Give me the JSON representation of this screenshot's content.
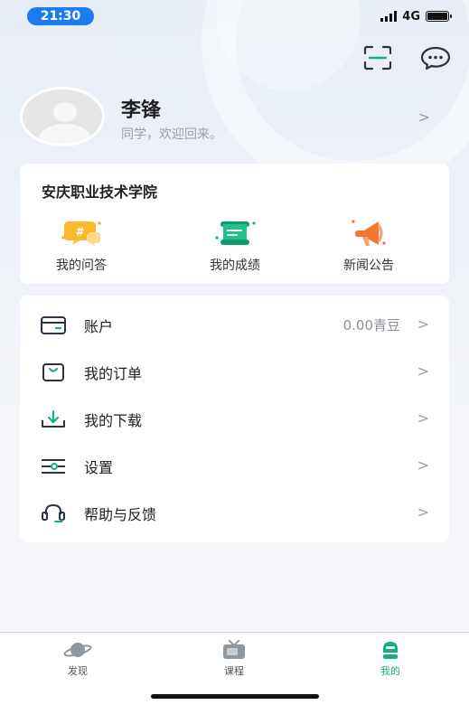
{
  "status_bar": {
    "time": "21:30",
    "network": "4G",
    "battery_level": 0.9
  },
  "header": {
    "scan_icon": "scan-icon",
    "message_icon": "chat-icon"
  },
  "profile": {
    "name": "李锋",
    "greeting": "同学，欢迎回来。",
    "chevron": ">"
  },
  "school": {
    "title": "安庆职业技术学院",
    "features": [
      {
        "label": "我的问答",
        "icon": "qa-bubble-icon",
        "color": "#f5a623"
      },
      {
        "label": "我的成绩",
        "icon": "scroll-icon",
        "color": "#18b07a"
      },
      {
        "label": "新闻公告",
        "icon": "megaphone-icon",
        "color": "#f26b2e"
      }
    ]
  },
  "menu": {
    "items": [
      {
        "label": "账户",
        "value": "0.00青豆",
        "icon": "wallet-icon",
        "chevron": ">"
      },
      {
        "label": "我的订单",
        "value": "",
        "icon": "order-bag-icon",
        "chevron": ">"
      },
      {
        "label": "我的下载",
        "value": "",
        "icon": "download-icon",
        "chevron": ">"
      },
      {
        "label": "设置",
        "value": "",
        "icon": "sliders-icon",
        "chevron": ">"
      },
      {
        "label": "帮助与反馈",
        "value": "",
        "icon": "headset-icon",
        "chevron": ">"
      }
    ]
  },
  "tabbar": {
    "tabs": [
      {
        "label": "发现",
        "icon": "planet-icon",
        "active": false
      },
      {
        "label": "课程",
        "icon": "tv-icon",
        "active": false
      },
      {
        "label": "我的",
        "icon": "profile-face-icon",
        "active": true
      }
    ]
  },
  "colors": {
    "accent": "#18b07a",
    "time_pill": "#1a7cf0"
  }
}
